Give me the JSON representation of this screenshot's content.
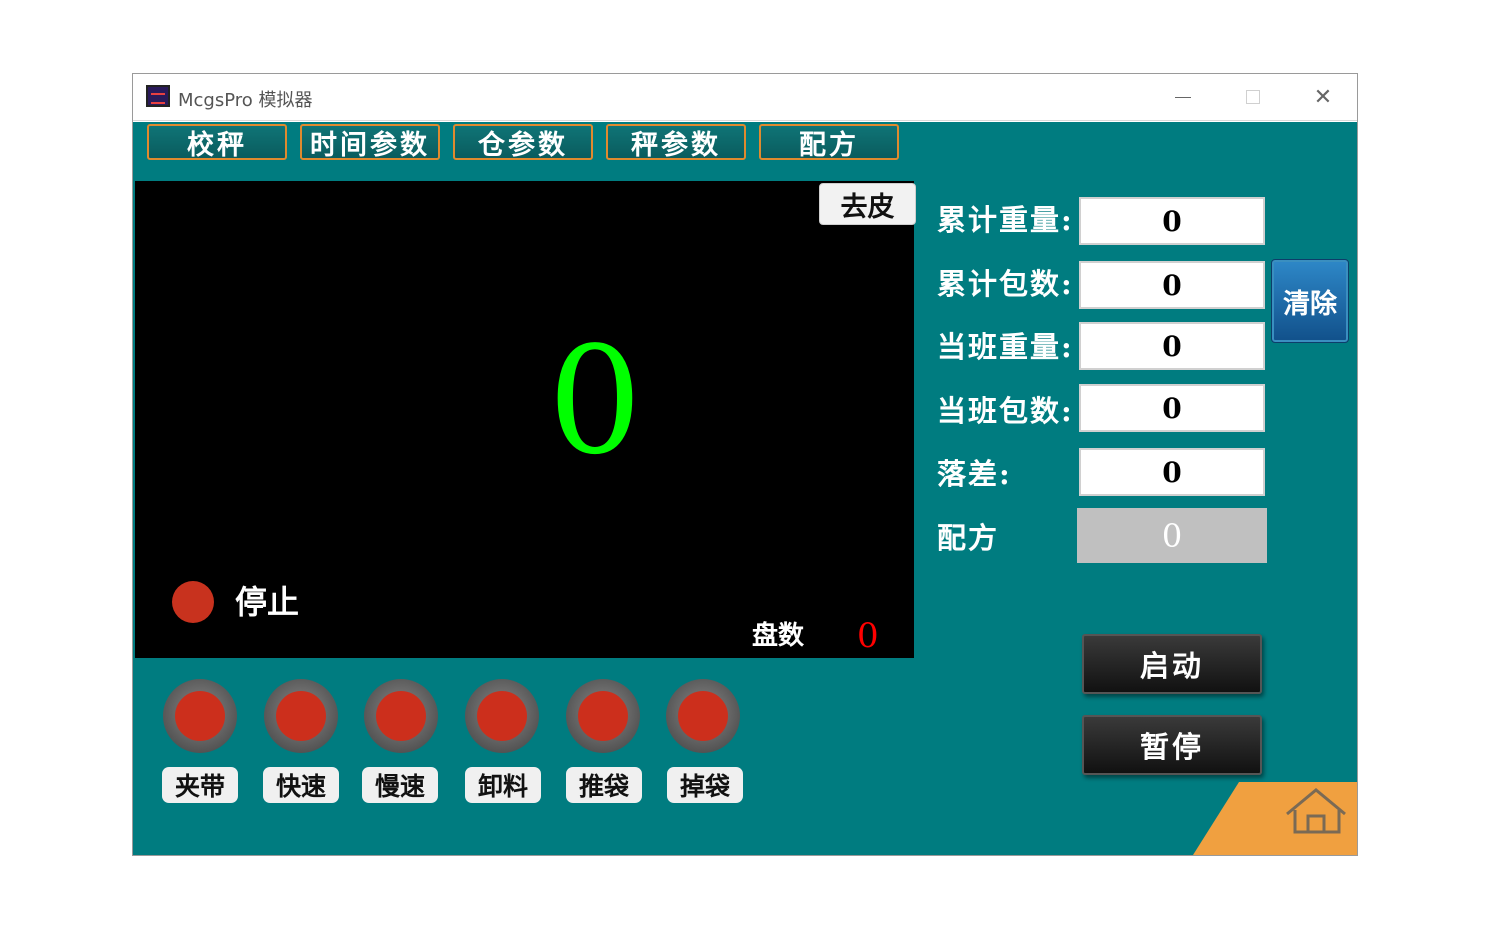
{
  "window": {
    "title": "McgsPro 模拟器",
    "minimize": "—",
    "close": "✕"
  },
  "tabs": [
    {
      "label": "校秤"
    },
    {
      "label": "时间参数"
    },
    {
      "label": "仓参数"
    },
    {
      "label": "秤参数"
    },
    {
      "label": "配方"
    }
  ],
  "display": {
    "tare_label": "去皮",
    "weight_value": "0",
    "status_text": "停止",
    "disk_label": "盘数",
    "disk_value": "0"
  },
  "fields": [
    {
      "label": "累计重量:",
      "value": "0"
    },
    {
      "label": "累计包数:",
      "value": "0"
    },
    {
      "label": "当班重量:",
      "value": "0"
    },
    {
      "label": "当班包数:",
      "value": "0"
    },
    {
      "label": "落差:",
      "value": "0"
    }
  ],
  "recipe": {
    "label": "配方",
    "value": "0"
  },
  "buttons": {
    "clear": "清除",
    "start": "启动",
    "pause": "暂停"
  },
  "lamps": [
    {
      "label": "夹带"
    },
    {
      "label": "快速"
    },
    {
      "label": "慢速"
    },
    {
      "label": "卸料"
    },
    {
      "label": "推袋"
    },
    {
      "label": "掉袋"
    }
  ],
  "colors": {
    "background": "#007c80",
    "tab_border": "#e08a2e",
    "weight_text": "#00ff00",
    "lamp_red": "#cc2f1c",
    "disk_value": "#ff0000",
    "home_corner": "#f0a040"
  },
  "icons": {
    "home": "home-icon"
  }
}
